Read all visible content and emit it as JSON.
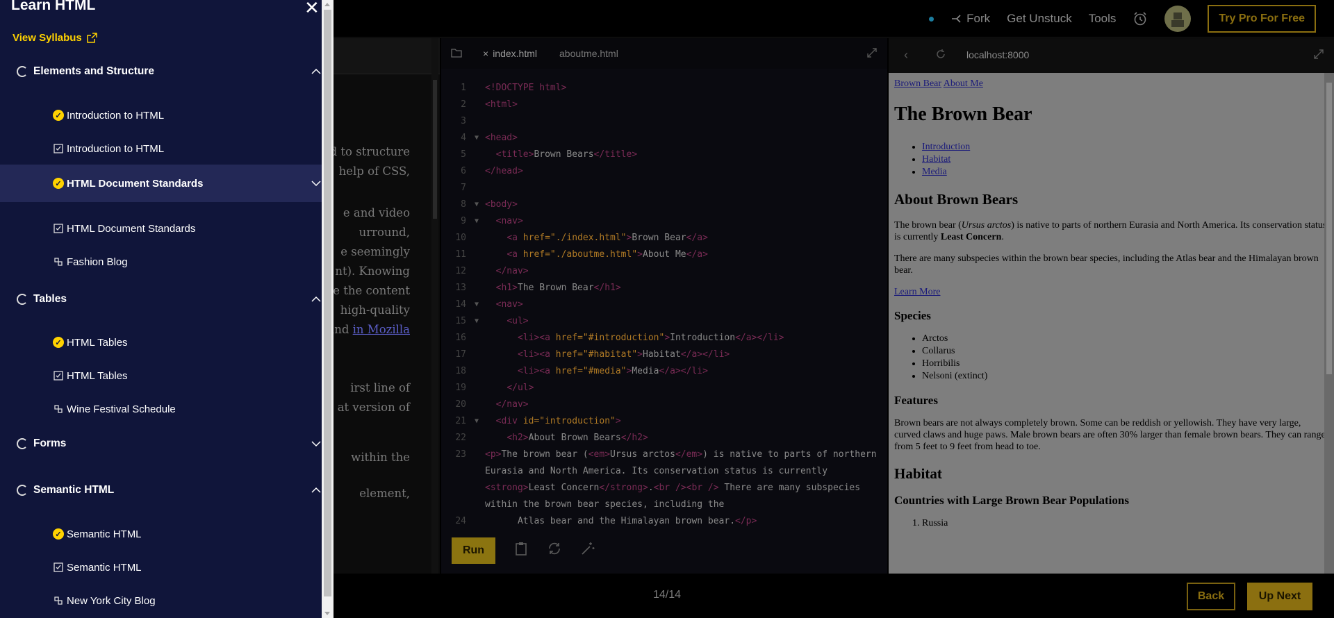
{
  "topbar": {
    "fork": "Fork",
    "get_unstuck": "Get Unstuck",
    "tools": "Tools",
    "pro_button": "Try Pro For Free"
  },
  "narrative": {
    "lines": [
      "d to structure",
      "help of CSS,",
      "e and video",
      "urround,",
      "e seemingly",
      "nt). Knowing",
      "e the content",
      "high-quality",
      "bund",
      "in Mozilla",
      "irst line of",
      "at version of",
      "within the",
      "element,"
    ]
  },
  "editor": {
    "tabs": [
      "index.html",
      "aboutme.html"
    ],
    "run_label": "Run",
    "lines": [
      {
        "n": "1",
        "html": "<span class='tag'>&lt;!DOCTYPE html&gt;</span>"
      },
      {
        "n": "2",
        "html": "<span class='tag'>&lt;html&gt;</span>"
      },
      {
        "n": "3",
        "html": ""
      },
      {
        "n": "4",
        "fold": true,
        "html": "<span class='tag'>&lt;head&gt;</span>"
      },
      {
        "n": "5",
        "html": "  <span class='tag'>&lt;title&gt;</span>Brown Bears<span class='tag'>&lt;/title&gt;</span>"
      },
      {
        "n": "6",
        "html": "<span class='tag'>&lt;/head&gt;</span>"
      },
      {
        "n": "7",
        "html": ""
      },
      {
        "n": "8",
        "fold": true,
        "html": "<span class='tag'>&lt;body&gt;</span>"
      },
      {
        "n": "9",
        "fold": true,
        "html": "  <span class='tag'>&lt;nav&gt;</span>"
      },
      {
        "n": "10",
        "html": "    <span class='tag'>&lt;a</span> <span class='attr'>href=\"./index.html\"</span><span class='tag'>&gt;</span>Brown Bear<span class='tag'>&lt;/a&gt;</span>"
      },
      {
        "n": "11",
        "html": "    <span class='tag'>&lt;a</span> <span class='attr'>href=\"./aboutme.html\"</span><span class='tag'>&gt;</span>About Me<span class='tag'>&lt;/a&gt;</span>"
      },
      {
        "n": "12",
        "html": "  <span class='tag'>&lt;/nav&gt;</span>"
      },
      {
        "n": "13",
        "html": "  <span class='tag'>&lt;h1&gt;</span>The Brown Bear<span class='tag'>&lt;/h1&gt;</span>"
      },
      {
        "n": "14",
        "fold": true,
        "html": "  <span class='tag'>&lt;nav&gt;</span>"
      },
      {
        "n": "15",
        "fold": true,
        "html": "    <span class='tag'>&lt;ul&gt;</span>"
      },
      {
        "n": "16",
        "html": "      <span class='tag'>&lt;li&gt;&lt;a</span> <span class='attr'>href=\"#introduction\"</span><span class='tag'>&gt;</span>Introduction<span class='tag'>&lt;/a&gt;&lt;/li&gt;</span>"
      },
      {
        "n": "17",
        "html": "      <span class='tag'>&lt;li&gt;&lt;a</span> <span class='attr'>href=\"#habitat\"</span><span class='tag'>&gt;</span>Habitat<span class='tag'>&lt;/a&gt;&lt;/li&gt;</span>"
      },
      {
        "n": "18",
        "html": "      <span class='tag'>&lt;li&gt;&lt;a</span> <span class='attr'>href=\"#media\"</span><span class='tag'>&gt;</span>Media<span class='tag'>&lt;/a&gt;&lt;/li&gt;</span>"
      },
      {
        "n": "19",
        "html": "    <span class='tag'>&lt;/ul&gt;</span>"
      },
      {
        "n": "20",
        "html": "  <span class='tag'>&lt;/nav&gt;</span>"
      },
      {
        "n": "21",
        "fold": true,
        "html": "  <span class='tag'>&lt;div</span> <span class='attr'>id=\"introduction\"</span><span class='tag'>&gt;</span>"
      },
      {
        "n": "22",
        "html": "    <span class='tag'>&lt;h2&gt;</span>About Brown Bears<span class='tag'>&lt;/h2&gt;</span>"
      }
    ],
    "line23_num": "23",
    "line23_html": "    <span class='tag'>&lt;p&gt;</span>The brown bear (<span class='tag'>&lt;em&gt;</span>Ursus arctos<span class='tag'>&lt;/em&gt;</span>) is native to parts of northern Eurasia and North America. Its conservation status is currently <span class='tag'>&lt;strong&gt;</span>Least Concern<span class='tag'>&lt;/strong&gt;</span>.<span class='tag'>&lt;br /&gt;&lt;br /&gt;</span> There are many subspecies within the brown bear species, including the",
    "line24_num": "24",
    "line24_html": "      Atlas bear and the Himalayan brown bear.<span class='tag'>&lt;/p&gt;</span>"
  },
  "browser": {
    "url": "localhost:8000",
    "nav_links": [
      "Brown Bear",
      "About Me"
    ],
    "h1": "The Brown Bear",
    "toc": [
      "Introduction",
      "Habitat",
      "Media"
    ],
    "about_heading": "About Brown Bears",
    "about_p1_a": "The brown bear (",
    "about_p1_em": "Ursus arctos",
    "about_p1_b": ") is native to parts of northern Eurasia and North America. Its conservation status is currently ",
    "about_p1_strong": "Least Concern",
    "about_p1_c": ".",
    "about_p2": "There are many subspecies within the brown bear species, including the Atlas bear and the Himalayan brown bear.",
    "learn_more": "Learn More",
    "species_heading": "Species",
    "species": [
      "Arctos",
      "Collarus",
      "Horribilis",
      "Nelsoni (extinct)"
    ],
    "features_heading": "Features",
    "features_text": "Brown bears are not always completely brown. Some can be reddish or yellowish. They have very large, curved claws and huge paws. Male brown bears are often 30% larger than female brown bears. They can range from 5 feet to 9 feet from head to toe.",
    "habitat_heading": "Habitat",
    "countries_heading": "Countries with Large Brown Bear Populations",
    "countries": [
      "Russia"
    ]
  },
  "footer": {
    "progress": "14/14",
    "back": "Back",
    "next": "Up Next"
  },
  "drawer": {
    "title": "Learn HTML",
    "view_syllabus": "View Syllabus",
    "sections": [
      {
        "label": "Elements and Structure",
        "expanded": true,
        "items": [
          {
            "label": "Introduction to HTML",
            "kind": "lesson-complete"
          },
          {
            "label": "Introduction to HTML",
            "kind": "quiz"
          },
          {
            "label": "HTML Document Standards",
            "kind": "lesson-complete",
            "active": true
          },
          {
            "label": "HTML Document Standards",
            "kind": "quiz"
          },
          {
            "label": "Fashion Blog",
            "kind": "project"
          }
        ]
      },
      {
        "label": "Tables",
        "expanded": true,
        "items": [
          {
            "label": "HTML Tables",
            "kind": "lesson-complete"
          },
          {
            "label": "HTML Tables",
            "kind": "quiz"
          },
          {
            "label": "Wine Festival Schedule",
            "kind": "project"
          }
        ]
      },
      {
        "label": "Forms",
        "expanded": false,
        "items": []
      },
      {
        "label": "Semantic HTML",
        "expanded": true,
        "items": [
          {
            "label": "Semantic HTML",
            "kind": "lesson-complete"
          },
          {
            "label": "Semantic HTML",
            "kind": "quiz"
          },
          {
            "label": "New York City Blog",
            "kind": "project"
          }
        ]
      }
    ]
  },
  "colors": {
    "accent_yellow": "#ffd200",
    "drawer_bg": "#10153a",
    "drawer_active": "#232856"
  }
}
